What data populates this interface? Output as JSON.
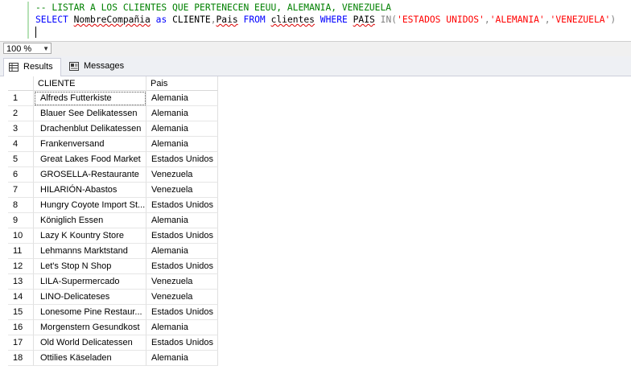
{
  "editor": {
    "comment": "-- LISTAR A LOS CLIENTES QUE PERTENECEN EEUU, ALEMANIA, VENEZUELA",
    "sql": {
      "select": "SELECT",
      "col1": "NombreCompañia",
      "as": "as",
      "alias": "CLIENTE",
      "col2": "Pais",
      "from": "FROM",
      "table": "clientes",
      "where": "WHERE",
      "pais": "PAIS",
      "in": "IN",
      "v1": "'ESTADOS UNIDOS'",
      "v2": "'ALEMANIA'",
      "v3": "'VENEZUELA'"
    }
  },
  "zoom": {
    "value": "100 %"
  },
  "tabs": [
    {
      "label": "Results",
      "icon": "grid-icon"
    },
    {
      "label": "Messages",
      "icon": "messages-icon"
    }
  ],
  "grid": {
    "columns": [
      "CLIENTE",
      "Pais"
    ],
    "rows": [
      {
        "n": "1",
        "cliente": "Alfreds Futterkiste",
        "pais": "Alemania"
      },
      {
        "n": "2",
        "cliente": "Blauer See Delikatessen",
        "pais": "Alemania"
      },
      {
        "n": "3",
        "cliente": "Drachenblut Delikatessen",
        "pais": "Alemania"
      },
      {
        "n": "4",
        "cliente": "Frankenversand",
        "pais": "Alemania"
      },
      {
        "n": "5",
        "cliente": "Great Lakes Food Market",
        "pais": "Estados Unidos"
      },
      {
        "n": "6",
        "cliente": "GROSELLA-Restaurante",
        "pais": "Venezuela"
      },
      {
        "n": "7",
        "cliente": "HILARIÓN-Abastos",
        "pais": "Venezuela"
      },
      {
        "n": "8",
        "cliente": "Hungry Coyote Import St...",
        "pais": "Estados Unidos"
      },
      {
        "n": "9",
        "cliente": "Königlich Essen",
        "pais": "Alemania"
      },
      {
        "n": "10",
        "cliente": "Lazy K Kountry Store",
        "pais": "Estados Unidos"
      },
      {
        "n": "11",
        "cliente": "Lehmanns Marktstand",
        "pais": "Alemania"
      },
      {
        "n": "12",
        "cliente": "Let's Stop N Shop",
        "pais": "Estados Unidos"
      },
      {
        "n": "13",
        "cliente": "LILA-Supermercado",
        "pais": "Venezuela"
      },
      {
        "n": "14",
        "cliente": "LINO-Delicateses",
        "pais": "Venezuela"
      },
      {
        "n": "15",
        "cliente": "Lonesome Pine Restaur...",
        "pais": "Estados Unidos"
      },
      {
        "n": "16",
        "cliente": "Morgenstern Gesundkost",
        "pais": "Alemania"
      },
      {
        "n": "17",
        "cliente": "Old World Delicatessen",
        "pais": "Estados Unidos"
      },
      {
        "n": "18",
        "cliente": "Ottilies Käseladen",
        "pais": "Alemania"
      }
    ]
  }
}
